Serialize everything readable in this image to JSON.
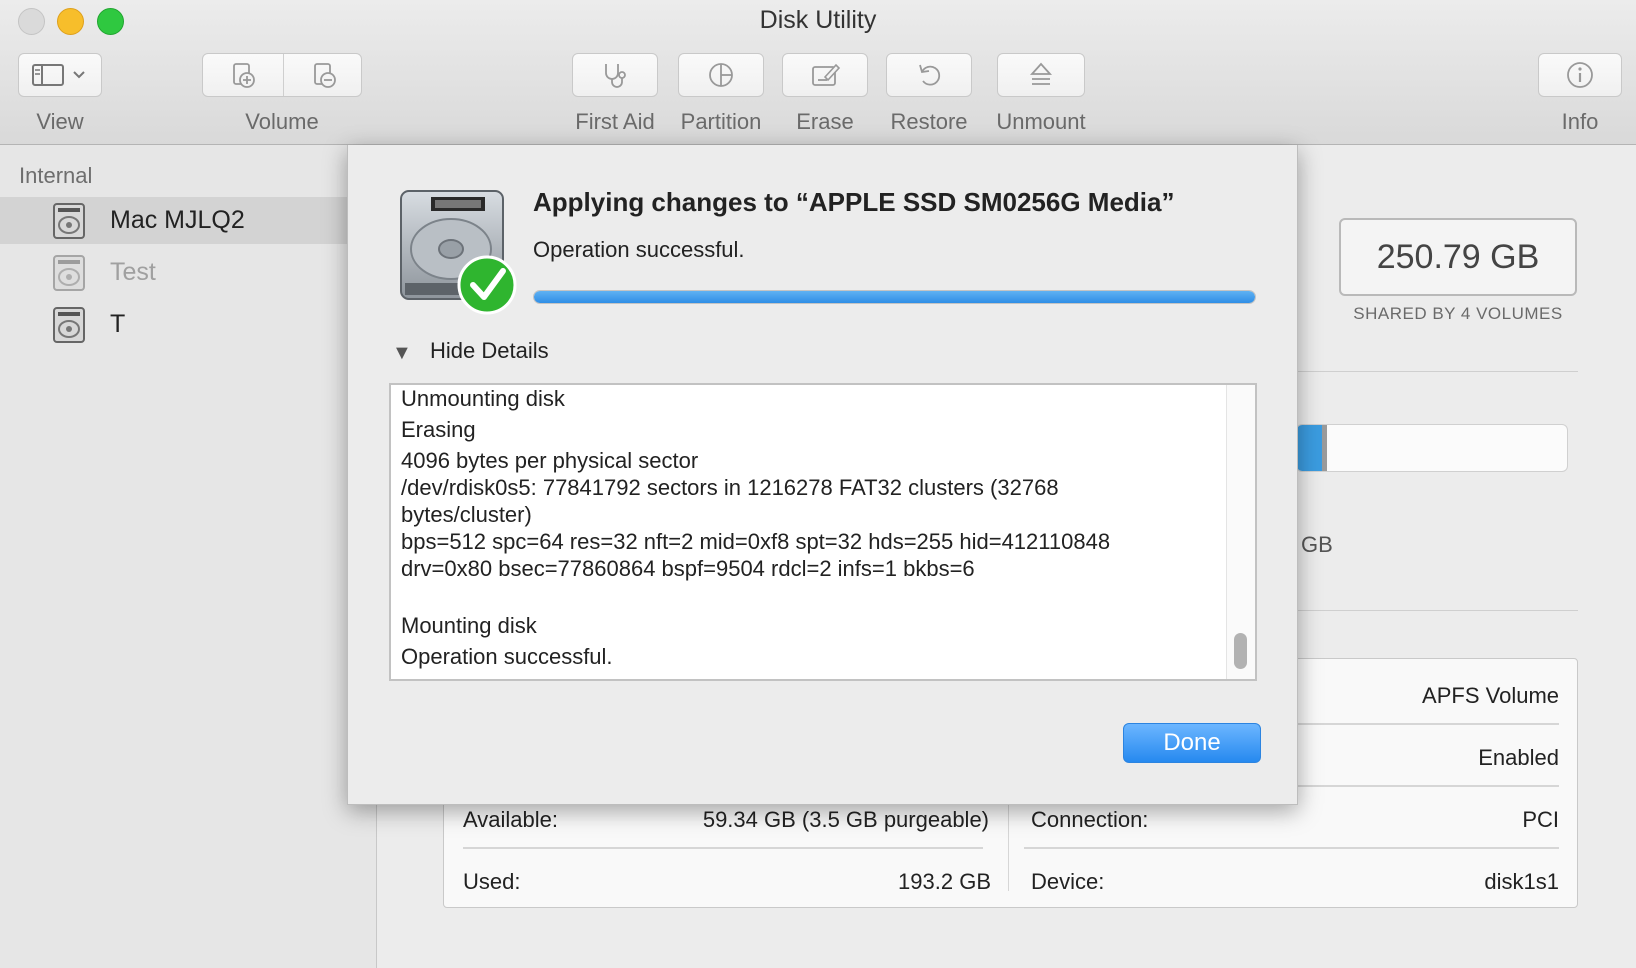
{
  "window": {
    "title": "Disk Utility"
  },
  "toolbar": {
    "view_label": "View",
    "volume_label": "Volume",
    "first_aid_label": "First Aid",
    "partition_label": "Partition",
    "erase_label": "Erase",
    "restore_label": "Restore",
    "unmount_label": "Unmount",
    "info_label": "Info"
  },
  "sidebar": {
    "section": "Internal",
    "items": [
      {
        "label": "Mac MJLQ2",
        "selected": true,
        "icon": "hard-drive-icon"
      },
      {
        "label": "Test",
        "selected": false,
        "dimmed": true,
        "icon": "hard-drive-icon"
      },
      {
        "label": "T",
        "selected": false,
        "icon": "hard-drive-icon"
      }
    ]
  },
  "volume": {
    "capacity": "250.79 GB",
    "capacity_sub": "SHARED BY 4 VOLUMES",
    "partial_gb": "GB",
    "details": {
      "type_value": "APFS Volume",
      "owners_value": "Enabled",
      "available_label": "Available:",
      "available_value": "59.34 GB (3.5 GB purgeable)",
      "connection_label": "Connection:",
      "connection_value": "PCI",
      "used_label": "Used:",
      "used_value": "193.2 GB",
      "device_label": "Device:",
      "device_value": "disk1s1"
    }
  },
  "dialog": {
    "title": "Applying changes to “APPLE SSD SM0256G Media”",
    "status": "Operation successful.",
    "progress": 1.0,
    "details_toggle": "Hide Details",
    "log": [
      "Unmounting disk",
      "Erasing",
      "4096 bytes per physical sector",
      "/dev/rdisk0s5: 77841792 sectors in 1216278 FAT32 clusters (32768 bytes/cluster)",
      "bps=512 spc=64 res=32 nft=2 mid=0xf8 spt=32 hds=255 hid=412110848",
      "drv=0x80 bsec=77860864 bspf=9504 rdcl=2 infs=1 bkbs=6",
      "",
      "Mounting disk",
      "Operation successful."
    ],
    "done_label": "Done"
  },
  "colors": {
    "accent_blue": "#2689ef",
    "progress_blue": "#3b9ce0",
    "success_green": "#2fb52f"
  }
}
